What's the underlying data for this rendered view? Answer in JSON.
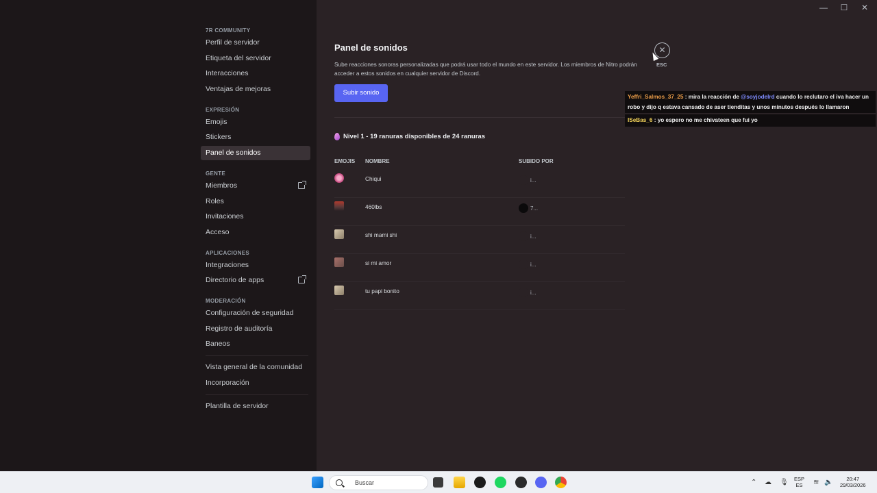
{
  "window": {
    "minimize": "—",
    "maximize": "☐",
    "close": "✕"
  },
  "sidebar": {
    "server_name": "7R COMMUNITY",
    "server_items": [
      "Perfil de servidor",
      "Etiqueta del servidor",
      "Interacciones",
      "Ventajas de mejoras"
    ],
    "expression_label": "EXPRESIÓN",
    "expression_items": [
      "Emojis",
      "Stickers",
      "Panel de sonidos"
    ],
    "people_label": "GENTE",
    "people_items": [
      "Miembros",
      "Roles",
      "Invitaciones",
      "Acceso"
    ],
    "apps_label": "APLICACIONES",
    "apps_items": [
      "Integraciones",
      "Directorio de apps"
    ],
    "moderation_label": "MODERACIÓN",
    "moderation_items": [
      "Configuración de seguridad",
      "Registro de auditoría",
      "Baneos"
    ],
    "community_items": [
      "Vista general de la comunidad",
      "Incorporación"
    ],
    "template_item": "Plantilla de servidor"
  },
  "main": {
    "title": "Panel de sonidos",
    "description": "Sube reacciones sonoras personalizadas que podrá usar todo el mundo en este servidor. Los miembros de Nitro podrán acceder a estos sonidos en cualquier servidor de Discord.",
    "upload_button": "Subir sonido",
    "level_text": "Nivel 1 - 19 ranuras disponibles de 24 ranuras",
    "columns": {
      "emojis": "EMOJIS",
      "name": "NOMBRE",
      "uploaded_by": "SUBIDO POR"
    },
    "sounds": [
      {
        "name": "Chiqui",
        "uploader": "i..."
      },
      {
        "name": "460lbs",
        "uploader": "7..."
      },
      {
        "name": "shi mami shi",
        "uploader": "i..."
      },
      {
        "name": "si mi amor",
        "uploader": "i..."
      },
      {
        "name": "tu papi bonito",
        "uploader": "i..."
      }
    ],
    "close_icon": "✕",
    "esc_label": "ESC"
  },
  "chat": {
    "m1_user": "Yeffri_Salmos_37_25",
    "m1_sep": " : mira la reacción de ",
    "m1_mention": "@soyjodelrd",
    "m1_text": " cuando lo reclutaro el iva hacer un robo y dijo q estava cansado de aser tienditas y unos minutos después lo llamaron",
    "m2_user": "ISeBas_6",
    "m2_text": " : yo espero no me chivateen que fui yo"
  },
  "taskbar": {
    "search_placeholder": "Buscar",
    "lang_top": "ESP",
    "lang_bottom": "ES",
    "time": "20:47",
    "date": "29/03/2026"
  }
}
